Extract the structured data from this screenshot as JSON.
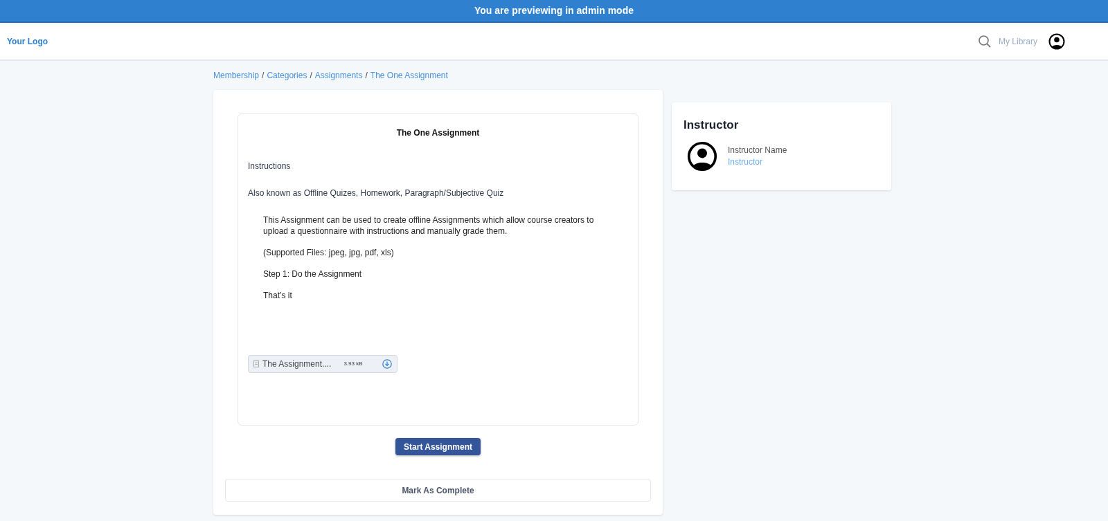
{
  "banner": {
    "text": "You are previewing in admin mode"
  },
  "header": {
    "logo": "Your Logo",
    "library_link": "My Library"
  },
  "breadcrumb": {
    "separator": "/",
    "items": [
      "Membership",
      "Categories",
      "Assignments",
      "The One Assignment"
    ]
  },
  "assignment": {
    "title": "The One Assignment",
    "heading": "Instructions",
    "subtitle": "Also known as Offline Quizes, Homework, Paragraph/Subjective Quiz",
    "paragraphs": [
      "This Assignment can be used to create offline Assignments which allow course creators to upload a questionnaire with instructions and manually grade them.",
      "(Supported Files: jpeg, jpg, pdf, xls)",
      "Step 1: Do the Assignment",
      "That’s it"
    ],
    "attachment": {
      "name": "The Assignment....",
      "size": "3.93 kB"
    }
  },
  "start_button": "Start Assignment",
  "complete_button": "Mark As Complete",
  "instructor": {
    "heading": "Instructor",
    "name": "Instructor Name",
    "role": "Instructor"
  }
}
